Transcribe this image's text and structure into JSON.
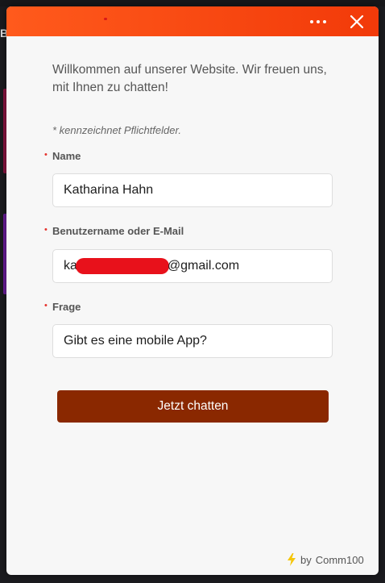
{
  "header": {
    "menu_icon": "more-horizontal-icon",
    "close_icon": "close-icon",
    "gradient_start": "#ff5a1c",
    "gradient_end": "#f23a09"
  },
  "welcome_text": "Willkommen auf unserer Website. Wir freuen uns, mit Ihnen zu chatten!",
  "required_note": "* kennzeichnet Pflichtfelder.",
  "form": {
    "name": {
      "label": "Name",
      "value": "Katharina Hahn"
    },
    "email": {
      "label": "Benutzername oder E-Mail",
      "value_prefix": "ka",
      "value_suffix": "@gmail.com"
    },
    "question": {
      "label": "Frage",
      "value": "Gibt es eine mobile App?"
    },
    "required_marker": "•",
    "submit_label": "Jetzt chatten",
    "submit_color": "#8a2800"
  },
  "branding": {
    "icon": "lightning-bolt-icon",
    "by_text": "by",
    "brand_name": "Comm100"
  },
  "background": {
    "partial_text": "Bc"
  }
}
